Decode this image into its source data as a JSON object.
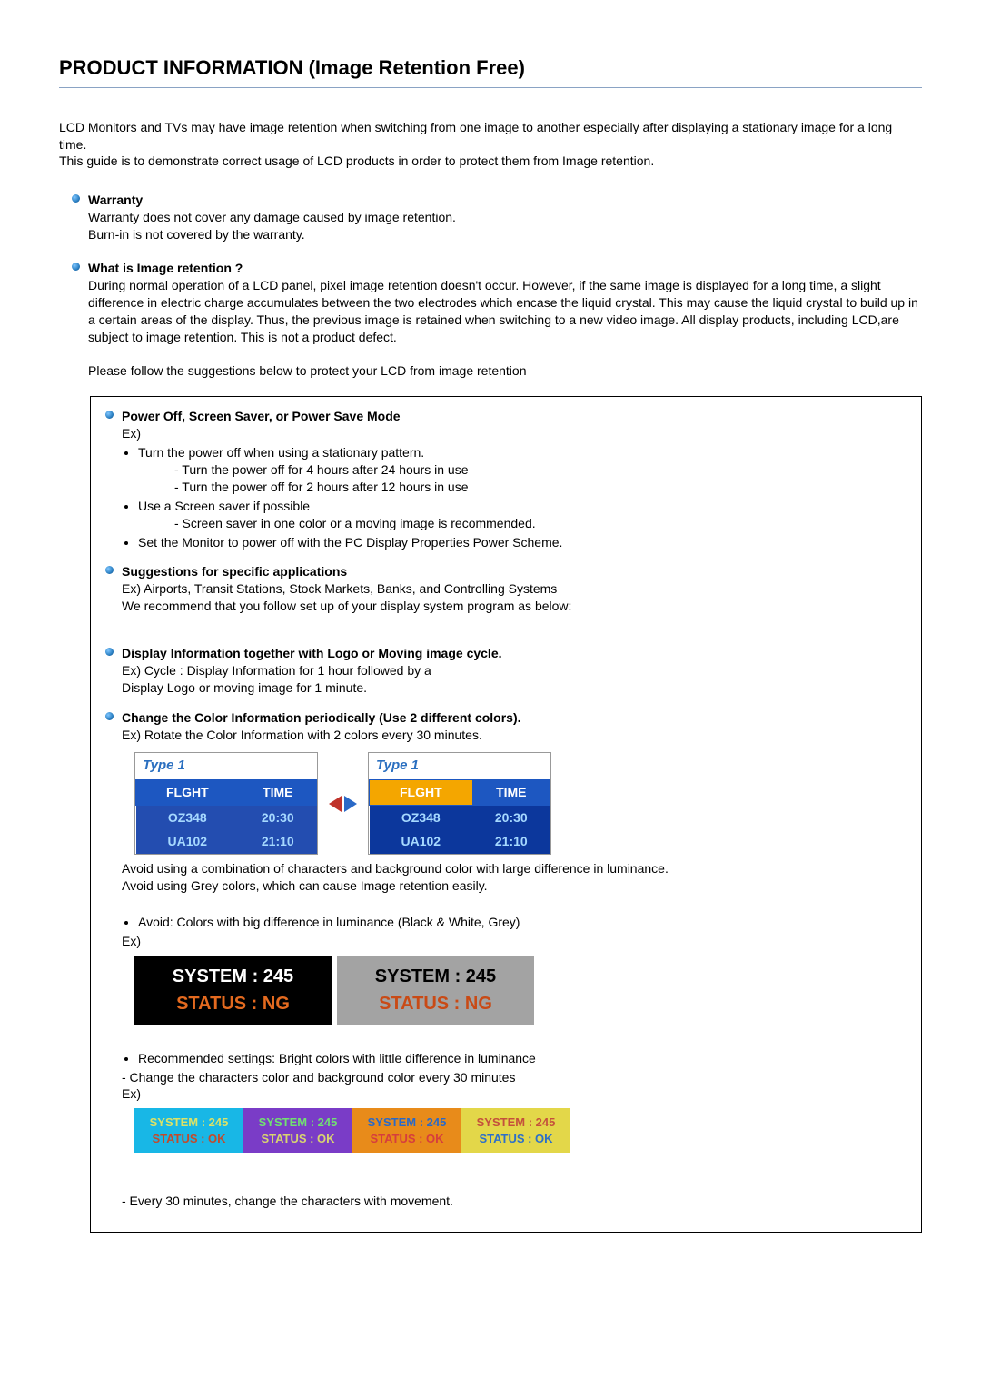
{
  "title": "PRODUCT INFORMATION (Image Retention Free)",
  "intro": {
    "p1": "LCD Monitors and TVs may have image retention when switching from one image to another especially after displaying a stationary image for a long time.",
    "p2": "This guide is to demonstrate correct usage of LCD products in order to protect them from Image retention."
  },
  "warranty": {
    "heading": "Warranty",
    "l1": "Warranty does not cover any damage caused by image retention.",
    "l2": "Burn-in is not covered by the warranty."
  },
  "whatis": {
    "heading": "What is Image retention ?",
    "body": "During normal operation of a LCD panel, pixel image retention doesn't occur. However, if the same image is displayed for a long time, a slight difference in electric charge accumulates between the two electrodes which encase the liquid crystal. This may cause the liquid crystal to build up in a certain areas of the display. Thus, the previous image is retained when switching to a new video image. All display products, including LCD,are subject to image retention. This is not a product defect.",
    "follow": "Please follow the suggestions below to protect your LCD from image retention"
  },
  "poweroff": {
    "heading": "Power Off, Screen Saver, or Power Save Mode",
    "ex": "Ex)",
    "b1": "Turn the power off when using a stationary pattern.",
    "b1a": "- Turn the power off for 4 hours after 24 hours in use",
    "b1b": "- Turn the power off for 2 hours after 12 hours in use",
    "b2": "Use a Screen saver if possible",
    "b2a": "- Screen saver in one color or a moving image is recommended.",
    "b3": "Set the Monitor to power off with the PC Display Properties Power Scheme."
  },
  "suggestions": {
    "heading": "Suggestions for specific applications",
    "l1": "Ex) Airports, Transit Stations, Stock Markets, Banks, and Controlling Systems",
    "l2": "We recommend that you follow set up of your display system program as below:"
  },
  "dispinfo": {
    "heading": "Display Information together with Logo or Moving image cycle.",
    "l1": "Ex) Cycle : Display Information for 1 hour followed by a",
    "l2": "Display Logo or moving image for 1 minute."
  },
  "changecolor": {
    "heading": "Change the Color Information periodically (Use 2 different colors).",
    "l1": "Ex) Rotate the Color Information with 2 colors every 30 minutes.",
    "fig1": {
      "typelabel": "Type 1",
      "th1": "FLGHT",
      "th2": "TIME",
      "rows": [
        {
          "f": "OZ348",
          "t": "20:30"
        },
        {
          "f": "UA102",
          "t": "21:10"
        }
      ]
    },
    "avoid1": "Avoid using a combination of characters and background color with large difference in luminance.",
    "avoid2": "Avoid using Grey colors, which can cause Image retention easily.",
    "avoidBullet": "Avoid: Colors with big difference in luminance (Black & White, Grey)",
    "ex2": "Ex)",
    "fig2": {
      "system": "SYSTEM : 245",
      "statusNg": "STATUS : NG"
    },
    "recBullet": "Recommended settings: Bright colors with little difference in luminance",
    "recLine": "- Change the characters color and background color every 30 minutes",
    "ex3": "Ex)",
    "fig3": {
      "system": "SYSTEM : 245",
      "statusOk": "STATUS : OK"
    },
    "finalLine": "- Every 30 minutes, change the characters with movement."
  }
}
